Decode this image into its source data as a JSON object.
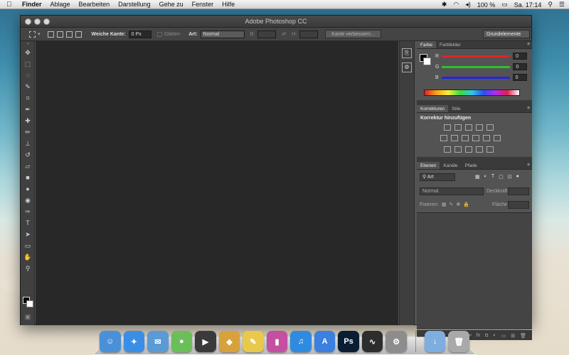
{
  "menubar": {
    "app": "Finder",
    "items": [
      "Ablage",
      "Bearbeiten",
      "Darstellung",
      "Gehe zu",
      "Fenster",
      "Hilfe"
    ],
    "battery": "100 %",
    "clock": "Sa. 17:14"
  },
  "window": {
    "title": "Adobe Photoshop CC"
  },
  "options": {
    "feather_label": "Weiche Kante:",
    "feather_value": "0 Px",
    "antialias_label": "Glätten",
    "style_label": "Art:",
    "style_value": "Normal",
    "width_label": "B:",
    "height_label": "H:",
    "refine_button": "Kante verbessern...",
    "workspace": "Grundelemente"
  },
  "tools": [
    "move-tool",
    "marquee-tool",
    "lasso-tool",
    "quick-select-tool",
    "crop-tool",
    "eyedropper-tool",
    "healing-tool",
    "brush-tool",
    "stamp-tool",
    "history-brush-tool",
    "eraser-tool",
    "gradient-tool",
    "blur-tool",
    "dodge-tool",
    "pen-tool",
    "type-tool",
    "path-select-tool",
    "shape-tool",
    "hand-tool",
    "zoom-tool"
  ],
  "color_panel": {
    "tabs": [
      "Farbe",
      "Farbfelder"
    ],
    "r_label": "R",
    "g_label": "G",
    "b_label": "B",
    "r": "0",
    "g": "0",
    "b": "0",
    "colors": {
      "r": "#e02424",
      "g": "#2fbf2f",
      "b": "#2424e0"
    }
  },
  "adjustments_panel": {
    "tabs": [
      "Korrekturen",
      "Stile"
    ],
    "title": "Korrektur hinzufügen"
  },
  "layers_panel": {
    "tabs": [
      "Ebenen",
      "Kanäle",
      "Pfade"
    ],
    "search": "Art",
    "blend_mode": "Normal",
    "opacity_label": "Deckkraft:",
    "lock_label": "Fixieren:",
    "fill_label": "Fläche:"
  },
  "dock": {
    "apps": [
      {
        "name": "finder",
        "color": "#4a90d9",
        "glyph": "☺"
      },
      {
        "name": "safari",
        "color": "#3a8ee6",
        "glyph": "✦"
      },
      {
        "name": "mail",
        "color": "#5b9bd5",
        "glyph": "✉"
      },
      {
        "name": "messages",
        "color": "#6bbf59",
        "glyph": "●"
      },
      {
        "name": "facetime",
        "color": "#3a3a3a",
        "glyph": "▶"
      },
      {
        "name": "iphoto",
        "color": "#d9a13b",
        "glyph": "◆"
      },
      {
        "name": "notes",
        "color": "#e8c94b",
        "glyph": "✎"
      },
      {
        "name": "charts",
        "color": "#c54fa0",
        "glyph": "▮"
      },
      {
        "name": "itunes",
        "color": "#2f8be0",
        "glyph": "♫"
      },
      {
        "name": "app-store",
        "color": "#3b7fe0",
        "glyph": "A"
      },
      {
        "name": "photoshop",
        "color": "#0a1d33",
        "glyph": "Ps"
      },
      {
        "name": "activity-monitor",
        "color": "#2d2d2d",
        "glyph": "∿"
      },
      {
        "name": "system-preferences",
        "color": "#8d8d8d",
        "glyph": "⚙"
      }
    ],
    "others": [
      {
        "name": "downloads",
        "color": "#7eaee0",
        "glyph": "↓"
      },
      {
        "name": "trash",
        "color": "#a9a9a9",
        "glyph": "🗑"
      }
    ]
  }
}
